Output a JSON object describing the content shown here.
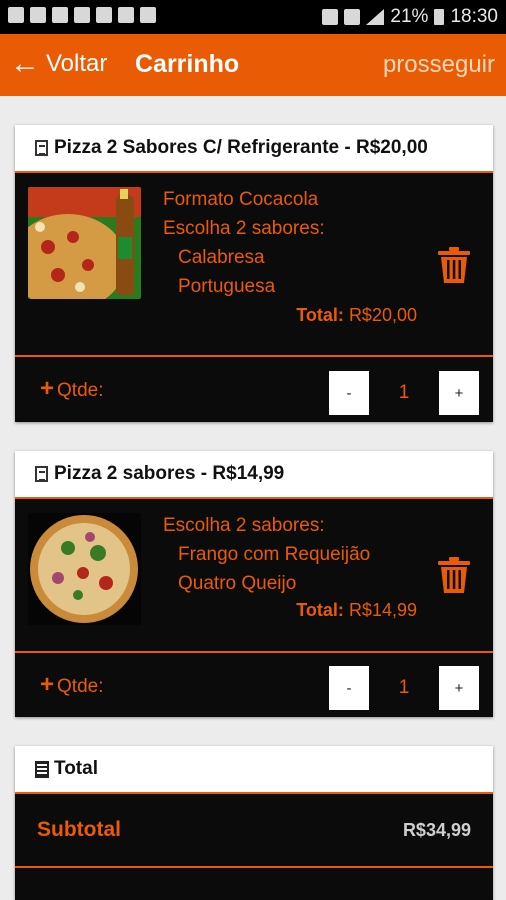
{
  "status_bar": {
    "battery": "21%",
    "time": "18:30"
  },
  "header": {
    "back_label": "Voltar",
    "title": "Carrinho",
    "next_label": "prosseguir"
  },
  "cart_items": [
    {
      "title": "Pizza 2 Sabores C/ Refrigerante - R$20,00",
      "option_line": "Formato Cocacola",
      "flavors_label": "Escolha 2 sabores:",
      "flavors": [
        "Calabresa",
        "Portuguesa"
      ],
      "total_label": "Total:",
      "total_value": "R$20,00",
      "qty_label": "Qtde:",
      "quantity": "1",
      "minus": "-",
      "plus": "+"
    },
    {
      "title": "Pizza 2 sabores - R$14,99",
      "flavors_label": "Escolha 2 sabores:",
      "flavors": [
        "Frango com Requeijão",
        "Quatro Queijo"
      ],
      "total_label": "Total:",
      "total_value": "R$14,99",
      "qty_label": "Qtde:",
      "quantity": "1",
      "minus": "-",
      "plus": "+"
    }
  ],
  "totals": {
    "title": "Total",
    "subtotal_label": "Subtotal",
    "subtotal_value": "R$34,99"
  },
  "colors": {
    "accent": "#e95b05",
    "card_bg": "#0b0b0b"
  },
  "icons": [
    "back-arrow-icon",
    "document-icon",
    "trash-icon",
    "calculator-icon"
  ]
}
